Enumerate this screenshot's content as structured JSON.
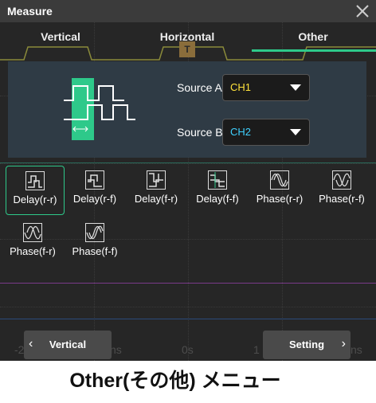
{
  "window": {
    "title": "Measure"
  },
  "tabs": [
    {
      "label": "Vertical",
      "active": false
    },
    {
      "label": "Horizontal",
      "active": false
    },
    {
      "label": "Other",
      "active": true
    }
  ],
  "trigger_marker": "T",
  "source_a": {
    "label": "Source A",
    "value": "CH1",
    "color": "#ffe23b"
  },
  "source_b": {
    "label": "Source B",
    "value": "CH2",
    "color": "#3fd1ff"
  },
  "measurements": [
    {
      "label": "Delay(r-r)",
      "icon": "delay-rise-rise-icon",
      "selected": true
    },
    {
      "label": "Delay(r-f)",
      "icon": "delay-rise-fall-icon",
      "selected": false
    },
    {
      "label": "Delay(f-r)",
      "icon": "delay-fall-rise-icon",
      "selected": false
    },
    {
      "label": "Delay(f-f)",
      "icon": "delay-fall-fall-icon",
      "selected": false
    },
    {
      "label": "Phase(r-r)",
      "icon": "phase-rise-rise-icon",
      "selected": false
    },
    {
      "label": "Phase(r-f)",
      "icon": "phase-rise-fall-icon",
      "selected": false
    },
    {
      "label": "Phase(f-r)",
      "icon": "phase-fall-rise-icon",
      "selected": false
    },
    {
      "label": "Phase(f-f)",
      "icon": "phase-fall-fall-icon",
      "selected": false
    }
  ],
  "footer": {
    "prev_label": "Vertical",
    "next_label": "Setting"
  },
  "axis_labels": [
    "-2",
    "ns",
    "0s",
    "1",
    "ns"
  ],
  "caption": "Other(その他) メニュー",
  "colors": {
    "accent": "#2ec98a",
    "panel": "#2f3b45",
    "ch1": "#ffe23b",
    "ch2": "#3fd1ff"
  }
}
